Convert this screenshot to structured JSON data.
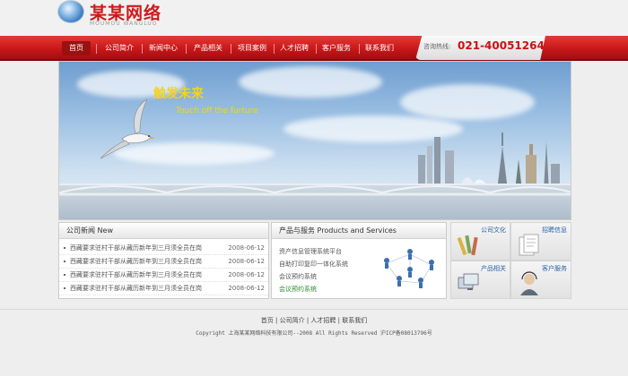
{
  "header": {
    "logo_title": "某某网络",
    "logo_sub": "MOUMOU WANGLUO"
  },
  "nav": {
    "items": [
      {
        "label": "首页",
        "active": true
      },
      {
        "label": "公司简介"
      },
      {
        "label": "新闻中心"
      },
      {
        "label": "产品相关"
      },
      {
        "label": "项目案例"
      },
      {
        "label": "人才招聘"
      },
      {
        "label": "客户服务"
      },
      {
        "label": "联系我们"
      }
    ],
    "hotline_label": "咨询热线:",
    "hotline_number": "021-40051264"
  },
  "banner": {
    "title": "触发未来",
    "subtitle": "Touch off the furture"
  },
  "news": {
    "title": "公司新闻 New",
    "items": [
      {
        "text": "西藏要求驻村干部从藏历新年到三月须全员在岗",
        "date": "2008-06-12"
      },
      {
        "text": "西藏要求驻村干部从藏历新年到三月须全员在岗",
        "date": "2008-06-12"
      },
      {
        "text": "西藏要求驻村干部从藏历新年到三月须全员在岗",
        "date": "2008-06-12"
      },
      {
        "text": "西藏要求驻村干部从藏历新年到三月须全员在岗",
        "date": "2008-06-12"
      }
    ]
  },
  "products": {
    "title": "产品与服务 Products and Services",
    "items": [
      "资产信息管理系统平台",
      "自助打印复印一体化系统",
      "会议预约系统",
      "会议预约系统"
    ]
  },
  "quick_links": [
    "公司文化",
    "招聘信息",
    "产品相关",
    "客户服务"
  ],
  "footer": {
    "links": [
      "首页",
      "公司简介",
      "人才招聘",
      "联系我们"
    ],
    "copyright": "Copyright 上海某某网络科技有限公司--2008 All Rights Reserved 沪ICP备08013796号"
  },
  "colors": {
    "brand_red": "#c8171a",
    "banner_text": "#f5d318",
    "link_blue": "#2b62a7"
  }
}
